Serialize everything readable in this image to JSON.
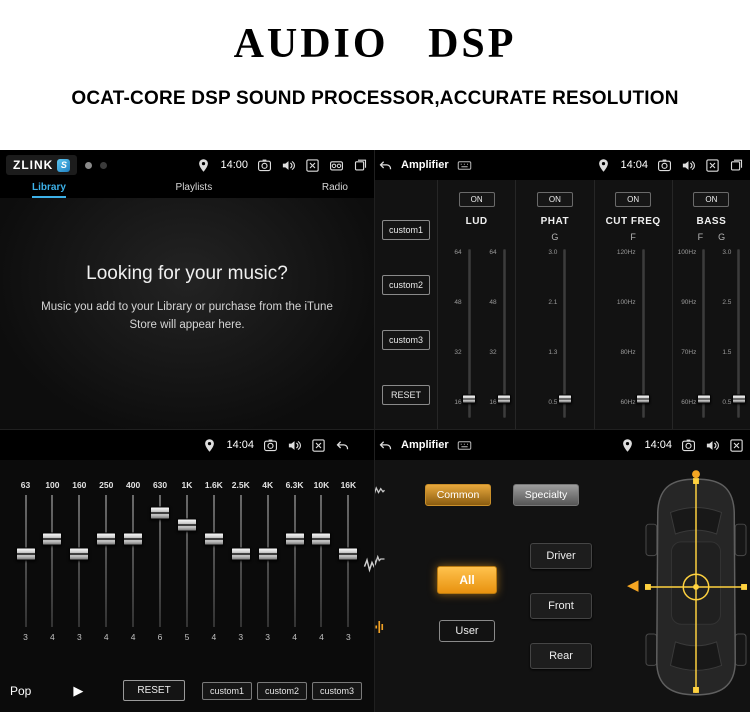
{
  "header": {
    "title": "AUDIO DSP",
    "subtitle": "OCAT-CORE DSP SOUND PROCESSOR,ACCURATE RESOLUTION"
  },
  "colors": {
    "accent_blue": "#3db1e8",
    "accent_orange": "#f0a125",
    "crosshair_yellow": "#ffd23f"
  },
  "music": {
    "brand": "ZLINK",
    "status_time": "14:00",
    "tabs": [
      {
        "label": "Library",
        "active": true
      },
      {
        "label": "Playlists",
        "active": false
      },
      {
        "label": "Radio",
        "active": false
      }
    ],
    "heading": "Looking for your music?",
    "body_line1": "Music you add to your Library or purchase from the iTune",
    "body_line2": "Store will appear here."
  },
  "dsp": {
    "title": "Amplifier",
    "status_time": "14:04",
    "preset_buttons": [
      "custom1",
      "custom2",
      "custom3",
      "RESET"
    ],
    "on_label": "ON",
    "channels": [
      {
        "name": "LUD",
        "sub": "",
        "sliders": [
          {
            "ticks": [
              "64",
              "48",
              "32",
              "16"
            ],
            "pos": 88
          },
          {
            "ticks": [
              "64",
              "48",
              "32",
              "16"
            ],
            "pos": 88
          }
        ]
      },
      {
        "name": "PHAT",
        "sub": "G",
        "sliders": [
          {
            "ticks": [
              "3.0",
              "2.1",
              "1.3",
              "0.5"
            ],
            "pos": 88
          }
        ]
      },
      {
        "name": "CUT FREQ",
        "sub": "F",
        "sliders": [
          {
            "ticks": [
              "120Hz",
              "100Hz",
              "80Hz",
              "60Hz"
            ],
            "pos": 88
          }
        ]
      },
      {
        "name": "BASS",
        "sub": "F      G",
        "sliders": [
          {
            "ticks": [
              "100Hz",
              "90Hz",
              "70Hz",
              "60Hz"
            ],
            "pos": 88
          },
          {
            "ticks": [
              "3.0",
              "2.5",
              "1.5",
              "0.5"
            ],
            "pos": 88
          }
        ]
      }
    ]
  },
  "eq": {
    "status_time": "14:04",
    "bands": [
      {
        "freq": "63",
        "value": "3",
        "pos": 45
      },
      {
        "freq": "100",
        "value": "4",
        "pos": 33
      },
      {
        "freq": "160",
        "value": "3",
        "pos": 45
      },
      {
        "freq": "250",
        "value": "4",
        "pos": 33
      },
      {
        "freq": "400",
        "value": "4",
        "pos": 33
      },
      {
        "freq": "630",
        "value": "6",
        "pos": 14
      },
      {
        "freq": "1K",
        "value": "5",
        "pos": 23
      },
      {
        "freq": "1.6K",
        "value": "4",
        "pos": 33
      },
      {
        "freq": "2.5K",
        "value": "3",
        "pos": 45
      },
      {
        "freq": "4K",
        "value": "3",
        "pos": 45
      },
      {
        "freq": "6.3K",
        "value": "4",
        "pos": 33
      },
      {
        "freq": "10K",
        "value": "4",
        "pos": 33
      },
      {
        "freq": "16K",
        "value": "3",
        "pos": 45
      }
    ],
    "preset_label": "Pop",
    "reset_label": "RESET",
    "custom_buttons": [
      "custom1",
      "custom2",
      "custom3"
    ]
  },
  "fader": {
    "title": "Amplifier",
    "status_time": "14:04",
    "tabs": [
      {
        "label": "Common",
        "active": true
      },
      {
        "label": "Specialty",
        "active": false
      }
    ],
    "zone_buttons": [
      {
        "label": "All",
        "active": true
      },
      {
        "label": "User",
        "active": false
      }
    ],
    "seat_buttons": [
      "Driver",
      "Front",
      "Rear"
    ]
  }
}
